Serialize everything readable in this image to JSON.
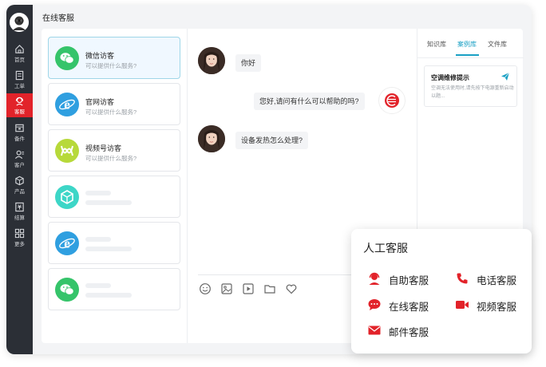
{
  "page_title": "在线客服",
  "rail": {
    "items": [
      {
        "label": "首页",
        "icon": "home-icon"
      },
      {
        "label": "工单",
        "icon": "ticket-icon"
      },
      {
        "label": "客服",
        "icon": "headset-icon",
        "active": true
      },
      {
        "label": "备件",
        "icon": "parts-icon"
      },
      {
        "label": "客户",
        "icon": "customer-icon"
      },
      {
        "label": "产品",
        "icon": "product-icon"
      },
      {
        "label": "结算",
        "icon": "settlement-icon"
      },
      {
        "label": "更多",
        "icon": "more-icon"
      }
    ]
  },
  "conversations": [
    {
      "name": "微信访客",
      "subtitle": "可以提供什么服务?",
      "icon": "wechat-icon",
      "color": "#35c46a",
      "selected": true
    },
    {
      "name": "官网访客",
      "subtitle": "可以提供什么服务?",
      "icon": "ie-icon",
      "color": "#2f9fe0"
    },
    {
      "name": "视频号访客",
      "subtitle": "可以提供什么服务?",
      "icon": "video-channel-icon",
      "color": "#b7d93a"
    },
    {
      "icon": "cube-icon",
      "color": "#3dd6c7"
    },
    {
      "icon": "ie-icon",
      "color": "#2f9fe0"
    },
    {
      "icon": "wechat-icon",
      "color": "#35c46a"
    }
  ],
  "messages": [
    {
      "from": "visitor",
      "text": "你好"
    },
    {
      "from": "agent",
      "text": "您好,请问有什么可以帮助的吗?"
    },
    {
      "from": "visitor",
      "text": "设备发热怎么处理?"
    }
  ],
  "toolbar_icons": [
    "emoji-icon",
    "image-icon",
    "video-icon",
    "folder-icon",
    "heart-icon"
  ],
  "side_tabs": [
    {
      "label": "知识库"
    },
    {
      "label": "案例库",
      "active": true
    },
    {
      "label": "文件库"
    }
  ],
  "knowledge_card": {
    "title": "空调维修提示",
    "desc": "空调无法使用时,请先按下电源重新启动以题..."
  },
  "popup": {
    "title": "人工客服",
    "services": [
      {
        "label": "自助客服",
        "icon": "self-service-icon"
      },
      {
        "label": "电话客服",
        "icon": "phone-icon"
      },
      {
        "label": "在线客服",
        "icon": "chat-icon"
      },
      {
        "label": "视频客服",
        "icon": "video-camera-icon"
      },
      {
        "label": "邮件客服",
        "icon": "mail-icon"
      }
    ]
  },
  "colors": {
    "accent": "#e2232a",
    "tab_active": "#1aa0c4",
    "rail_bg": "#2b2f36"
  }
}
